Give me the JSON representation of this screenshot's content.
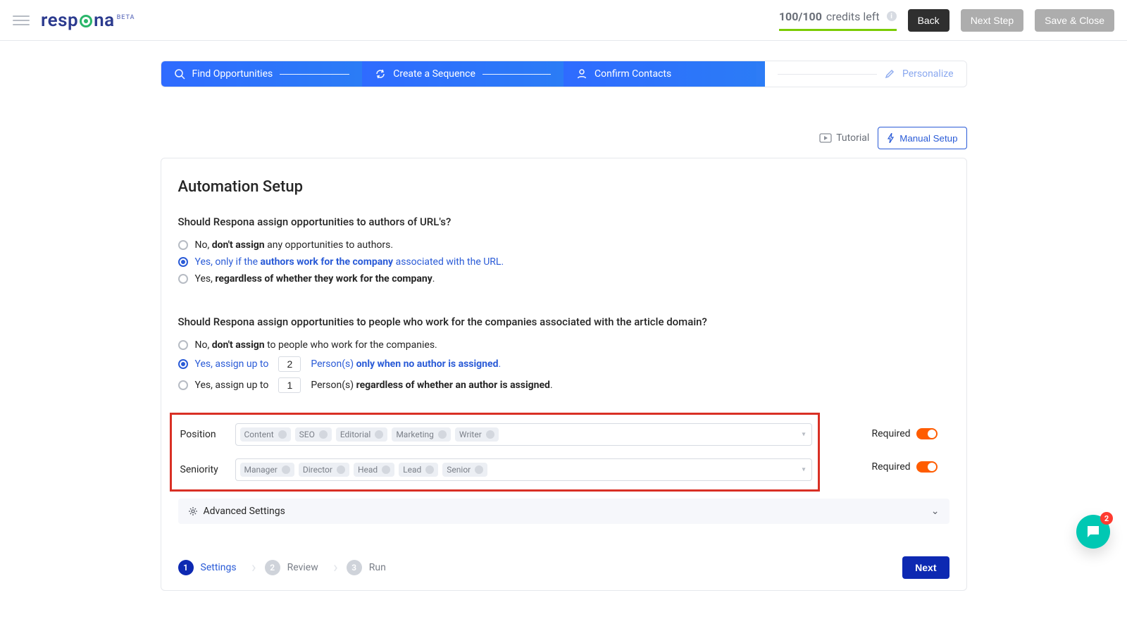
{
  "topbar": {
    "logo_text_a": "resp",
    "logo_text_b": "na",
    "logo_beta": "BETA",
    "credits_num": "100/100",
    "credits_label": "credits left",
    "back": "Back",
    "next_step": "Next Step",
    "save_close": "Save & Close"
  },
  "wizard": {
    "steps": [
      {
        "label": "Find Opportunities",
        "icon": "search-icon",
        "active": true
      },
      {
        "label": "Create a Sequence",
        "icon": "refresh-icon",
        "active": true
      },
      {
        "label": "Confirm Contacts",
        "icon": "user-icon",
        "active": true
      },
      {
        "label": "Personalize",
        "icon": "edit-icon",
        "active": false
      }
    ]
  },
  "setup_strip": {
    "tutorial": "Tutorial",
    "manual_setup": "Manual Setup"
  },
  "panel": {
    "title": "Automation Setup",
    "q1": "Should Respona assign opportunities to authors of URL's?",
    "q1_options": [
      {
        "pre": "No, ",
        "bold": "don't assign",
        "post": " any opportunities to authors.",
        "selected": false
      },
      {
        "pre": "Yes, only if the ",
        "bold": "authors work for the company",
        "post": " associated with the URL.",
        "selected": true
      },
      {
        "pre": "Yes, ",
        "bold": "regardless of whether they work for the company",
        "post": ".",
        "selected": false
      }
    ],
    "q2": "Should Respona assign opportunities to people who work for the companies associated with the article domain?",
    "q2_options": [
      {
        "type": "plain",
        "pre": "No, ",
        "bold": "don't assign",
        "post": " to people who work for the companies.",
        "selected": false
      },
      {
        "type": "num",
        "pre": "Yes, assign up to",
        "num": "2",
        "mid": "Person(s) ",
        "bold": "only when no author is assigned",
        "post": ".",
        "selected": true
      },
      {
        "type": "num",
        "pre": "Yes, assign up to",
        "num": "1",
        "mid": "Person(s) ",
        "bold": "regardless of whether an author is assigned",
        "post": ".",
        "selected": false
      }
    ],
    "position_label": "Position",
    "position_chips": [
      "Content",
      "SEO",
      "Editorial",
      "Marketing",
      "Writer"
    ],
    "seniority_label": "Seniority",
    "seniority_chips": [
      "Manager",
      "Director",
      "Head",
      "Lead",
      "Senior"
    ],
    "required_label": "Required",
    "position_required": true,
    "seniority_required": true,
    "advanced_settings": "Advanced Settings"
  },
  "bottom_steps": [
    {
      "n": "1",
      "label": "Settings",
      "active": true
    },
    {
      "n": "2",
      "label": "Review",
      "active": false
    },
    {
      "n": "3",
      "label": "Run",
      "active": false
    }
  ],
  "next_button": "Next",
  "chat_badge": "2"
}
